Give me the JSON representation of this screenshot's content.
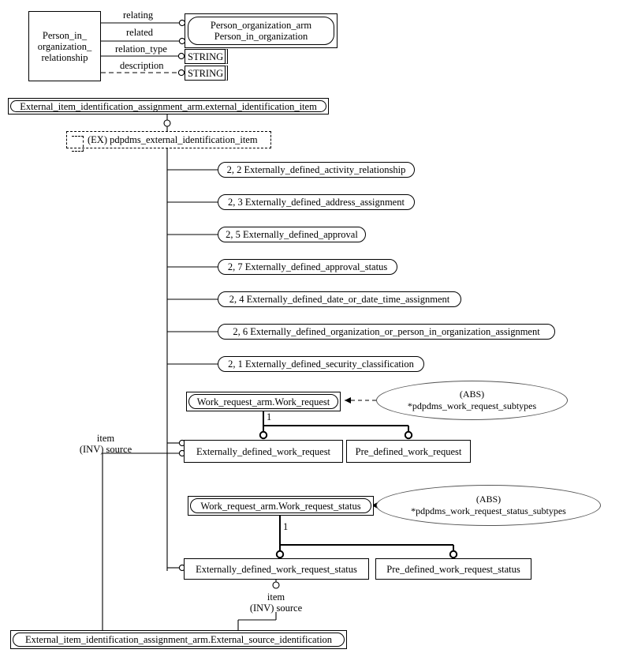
{
  "diagram": {
    "title": "EXPRESS-G entity level diagram",
    "line_color": "#000000",
    "background": "#ffffff"
  },
  "nodes": {
    "person_in_organization_relationship": {
      "label_lines": [
        "Person_in_",
        "organization_",
        "relationship"
      ],
      "kind": "entity-rect"
    },
    "person_organization_arm": {
      "label_lines": [
        "Person_organization_arm",
        "Person_in_organization"
      ],
      "kind": "interfaced-entity"
    },
    "string_relation_type": {
      "label": "STRING",
      "kind": "primitive"
    },
    "string_description": {
      "label": "STRING",
      "kind": "primitive"
    },
    "external_identification_item": {
      "label": "External_item_identification_assignment_arm.external_identification_item",
      "kind": "interfaced-select"
    },
    "ex_pdpdms_external_identification_item": {
      "label": "(EX) pdpdms_external_identification_item",
      "kind": "ex-interface"
    },
    "work_request_arm_work_request": {
      "label": "Work_request_arm.Work_request",
      "kind": "interfaced-entity"
    },
    "externally_defined_work_request": {
      "label": "Externally_defined_work_request",
      "kind": "entity-rect"
    },
    "pre_defined_work_request": {
      "label": "Pre_defined_work_request",
      "kind": "entity-rect"
    },
    "work_request_arm_work_request_status": {
      "label": "Work_request_arm.Work_request_status",
      "kind": "interfaced-entity"
    },
    "externally_defined_work_request_status": {
      "label": "Externally_defined_work_request_status",
      "kind": "entity-rect"
    },
    "pre_defined_work_request_status": {
      "label": "Pre_defined_work_request_status",
      "kind": "entity-rect"
    },
    "external_source_identification": {
      "label": "External_item_identification_assignment_arm.External_source_identification",
      "kind": "interfaced-entity"
    }
  },
  "select_branches": [
    {
      "id": "activity_relationship",
      "label": "2, 2 Externally_defined_activity_relationship"
    },
    {
      "id": "address_assignment",
      "label": "2, 3 Externally_defined_address_assignment"
    },
    {
      "id": "approval",
      "label": "2, 5 Externally_defined_approval"
    },
    {
      "id": "approval_status",
      "label": "2, 7 Externally_defined_approval_status"
    },
    {
      "id": "date_or_date_time_assignment",
      "label": "2, 4 Externally_defined_date_or_date_time_assignment"
    },
    {
      "id": "organization_or_person_in_organization_assignment",
      "label": "2, 6 Externally_defined_organization_or_person_in_organization_assignment"
    },
    {
      "id": "security_classification",
      "label": "2, 1 Externally_defined_security_classification"
    }
  ],
  "attribute_labels": {
    "relating": "relating",
    "related": "related",
    "relation_type": "relation_type",
    "description": "description",
    "item_inv_source_upper_line1": "item",
    "item_inv_source_upper_line2": "(INV) source",
    "item_inv_source_lower_line1": "item",
    "item_inv_source_lower_line2": "(INV) source"
  },
  "cardinalities": {
    "work_request_supertype": "1",
    "work_request_status_supertype": "1"
  },
  "constraints": {
    "work_request_subtypes": {
      "line1": "(ABS)",
      "line2": "*pdpdms_work_request_subtypes"
    },
    "work_request_status_subtypes": {
      "line1": "(ABS)",
      "line2": "*pdpdms_work_request_status_subtypes"
    }
  }
}
